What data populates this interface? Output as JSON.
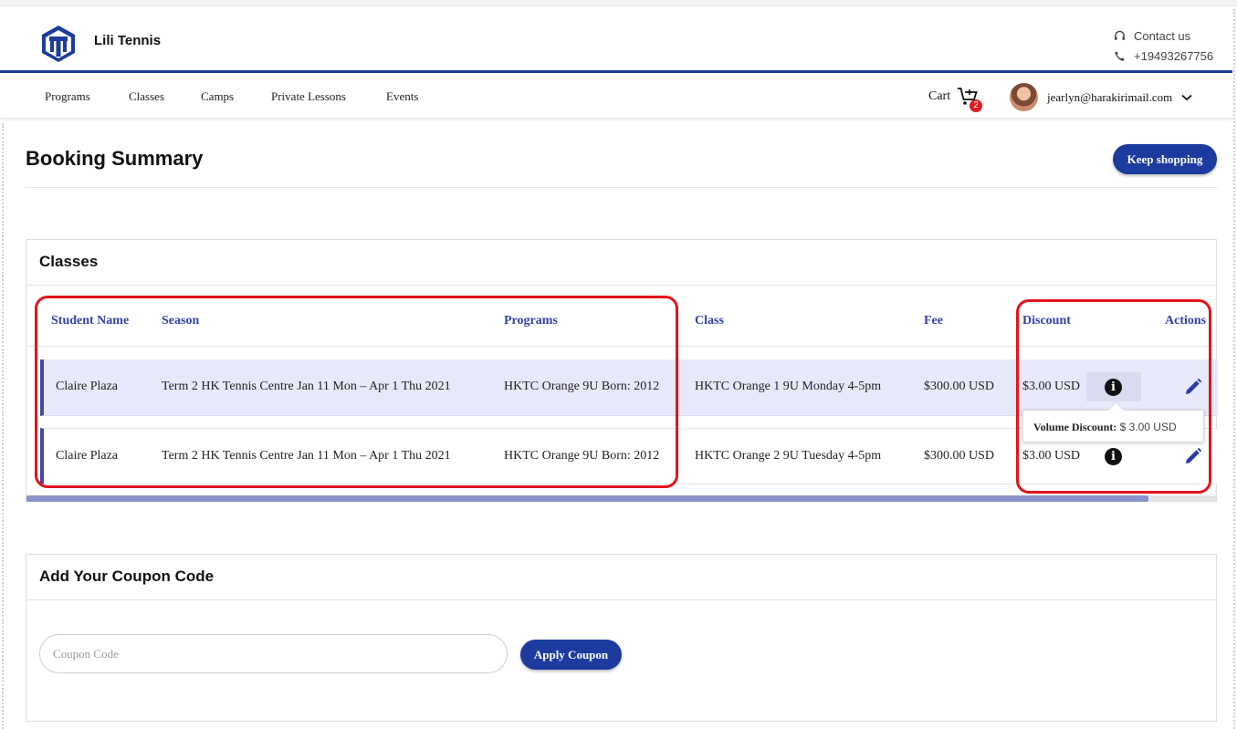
{
  "header": {
    "brand": "Lili Tennis",
    "contact_label": "Contact us",
    "phone": "+19493267756"
  },
  "nav": {
    "items": [
      "Programs",
      "Classes",
      "Camps",
      "Private Lessons",
      "Events"
    ],
    "cart_label": "Cart",
    "cart_count": "2",
    "user_email": "jearlyn@harakirimail.com"
  },
  "page": {
    "title": "Booking Summary",
    "keep_shopping": "Keep shopping"
  },
  "classes": {
    "heading": "Classes",
    "columns": [
      "Student Name",
      "Season",
      "Programs",
      "Class",
      "Fee",
      "Discount",
      "Actions"
    ],
    "rows": [
      {
        "student": "Claire Plaza",
        "season": "Term 2 HK Tennis Centre Jan 11 Mon – Apr 1 Thu 2021",
        "program": "HKTC Orange 9U Born: 2012",
        "class": "HKTC Orange 1 9U Monday 4-5pm",
        "fee": "$300.00 USD",
        "discount": "$3.00 USD"
      },
      {
        "student": "Claire Plaza",
        "season": "Term 2 HK Tennis Centre Jan 11 Mon – Apr 1 Thu 2021",
        "program": "HKTC Orange 9U Born: 2012",
        "class": "HKTC Orange 2 9U Tuesday 4-5pm",
        "fee": "$300.00 USD",
        "discount": "$3.00 USD"
      }
    ],
    "tooltip": {
      "label": "Volume Discount:",
      "value": "$ 3.00 USD"
    }
  },
  "coupon": {
    "heading": "Add Your Coupon Code",
    "placeholder": "Coupon Code",
    "apply": "Apply Coupon"
  },
  "colors": {
    "brand_blue": "#1b3b9e",
    "header_accent": "#1d3aa0",
    "column_header": "#3441a8",
    "annotation_red": "#e3141b",
    "badge_red": "#e0191e",
    "selected_row": "#e7e9fb"
  }
}
